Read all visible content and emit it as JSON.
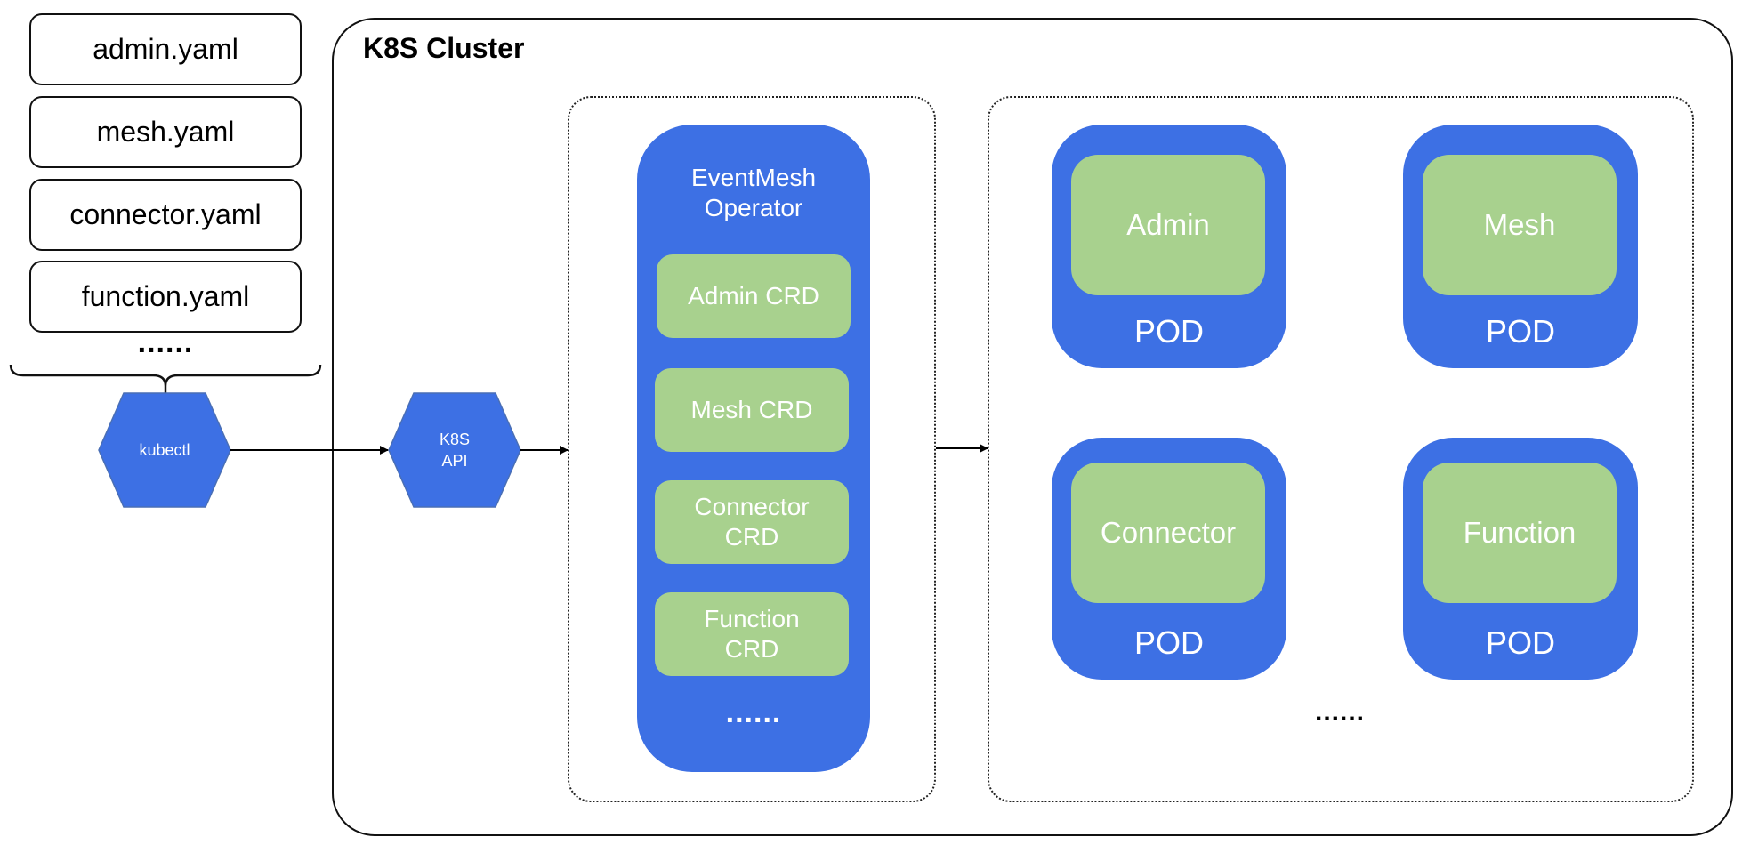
{
  "yaml_files": [
    {
      "label": "admin.yaml"
    },
    {
      "label": "mesh.yaml"
    },
    {
      "label": "connector.yaml"
    },
    {
      "label": "function.yaml"
    }
  ],
  "yaml_more": "......",
  "kubectl": {
    "label": "kubectl"
  },
  "k8s_api": {
    "line1": "K8S",
    "line2": "API"
  },
  "cluster": {
    "title": "K8S Cluster"
  },
  "operator": {
    "title_line1": "EventMesh",
    "title_line2": "Operator",
    "crds": [
      {
        "line1": "Admin CRD",
        "line2": ""
      },
      {
        "line1": "Mesh CRD",
        "line2": ""
      },
      {
        "line1": "Connector",
        "line2": "CRD"
      },
      {
        "line1": "Function",
        "line2": "CRD"
      }
    ],
    "more": "......"
  },
  "pods": [
    {
      "name": "Admin",
      "label": "POD"
    },
    {
      "name": "Mesh",
      "label": "POD"
    },
    {
      "name": "Connector",
      "label": "POD"
    },
    {
      "name": "Function",
      "label": "POD"
    }
  ],
  "pods_more": "......",
  "colors": {
    "blue": "#3d70e4",
    "green": "#a8d18e",
    "hex_stroke": "#4a6fb5"
  }
}
